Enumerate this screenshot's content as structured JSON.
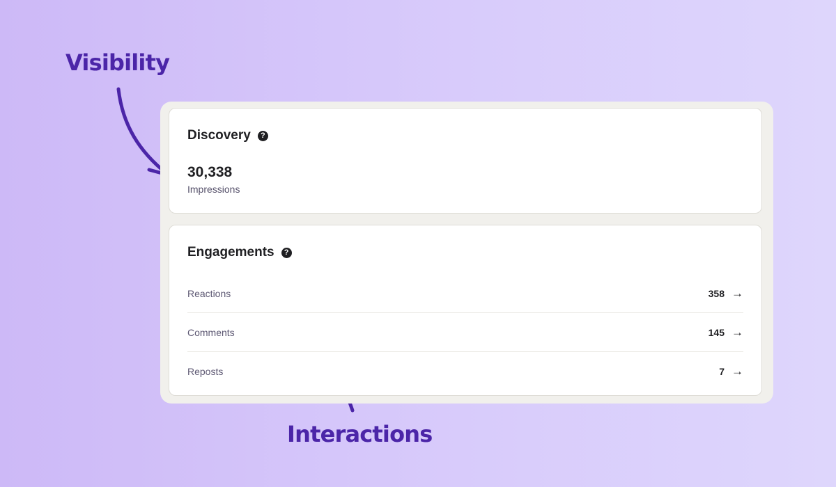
{
  "annotations": {
    "visibility": "Visibility",
    "interactions": "Interactions"
  },
  "colors": {
    "annotation": "#4b25a8",
    "text": "#1f1f22",
    "muted": "#5d5873",
    "panel": "#f1f0ec",
    "card": "#ffffff"
  },
  "discovery": {
    "title": "Discovery",
    "help_icon": "?",
    "value": "30,338",
    "label": "Impressions"
  },
  "engagements": {
    "title": "Engagements",
    "help_icon": "?",
    "arrow_icon": "→",
    "rows": [
      {
        "label": "Reactions",
        "value": "358"
      },
      {
        "label": "Comments",
        "value": "145"
      },
      {
        "label": "Reposts",
        "value": "7"
      }
    ]
  }
}
